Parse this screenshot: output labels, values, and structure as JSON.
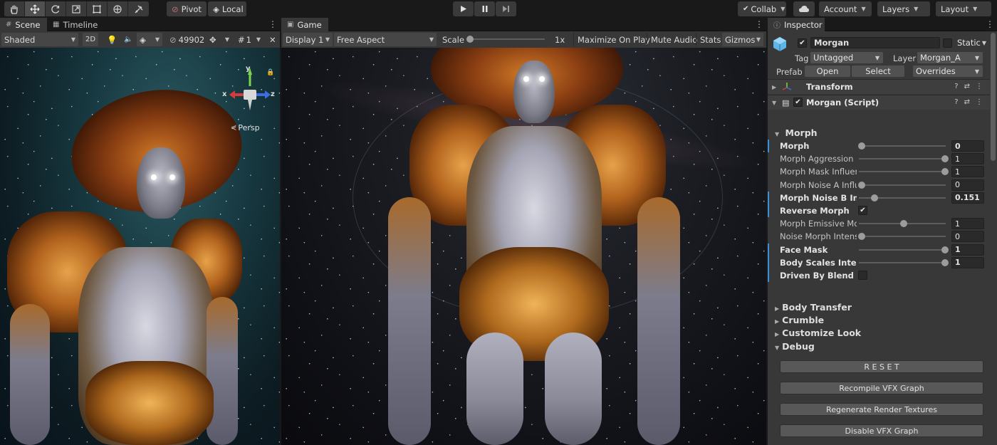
{
  "toolbar": {
    "tools": [
      "hand-tool",
      "move-tool",
      "rotate-tool",
      "scale-tool",
      "rect-tool",
      "transform-tool",
      "custom-tool"
    ],
    "pivot_label": "Pivot",
    "local_label": "Local",
    "collab_label": "Collab",
    "account_label": "Account",
    "layers_label": "Layers",
    "layout_label": "Layout"
  },
  "scene_panel": {
    "tabs": [
      {
        "label": "Scene"
      },
      {
        "label": "Timeline"
      }
    ],
    "shading_mode": "Shaded",
    "mode_2d": "2D",
    "vertex_count": "49902",
    "layer_count": "1",
    "gizmo": {
      "x": "x",
      "y": "y",
      "z": "z",
      "view_label": "Persp"
    }
  },
  "game_panel": {
    "tab_label": "Game",
    "display": "Display 1",
    "aspect": "Free Aspect",
    "scale_label": "Scale",
    "scale_value": 0,
    "scale_readout": "1x",
    "maximize_label": "Maximize On Play",
    "mute_label": "Mute Audio",
    "stats_label": "Stats",
    "gizmos_label": "Gizmos"
  },
  "inspector": {
    "tab_label": "Inspector",
    "object_name": "Morgan",
    "active": true,
    "static_label": "Static",
    "tag_label": "Tag",
    "tag_value": "Untagged",
    "layer_label": "Layer",
    "layer_value": "Morgan_A",
    "prefab_label": "Prefab",
    "open_label": "Open",
    "select_label": "Select",
    "overrides_label": "Overrides",
    "transform_title": "Transform",
    "script_title": "Morgan (Script)",
    "morph_section": "Morph",
    "properties": [
      {
        "label": "Morph",
        "value": "0",
        "slider": 0.0,
        "bold": true,
        "bar": true
      },
      {
        "label": "Morph Aggression",
        "value": "1",
        "slider": 1.0,
        "bold": false,
        "bar": false
      },
      {
        "label": "Morph Mask Influence",
        "value": "1",
        "slider": 1.0,
        "bold": false,
        "bar": false
      },
      {
        "label": "Morph Noise A Influence",
        "value": "0",
        "slider": 0.0,
        "bold": false,
        "bar": false
      },
      {
        "label": "Morph Noise B Influence",
        "value": "0.151",
        "slider": 0.151,
        "bold": true,
        "bar": true
      },
      {
        "label": "Reverse Morph",
        "checkbox": true,
        "bold": true,
        "bar": true
      },
      {
        "label": "Morph Emissive Mod",
        "value": "1",
        "slider": 0.5,
        "bold": false,
        "bar": false
      },
      {
        "label": "Noise Morph Intensity",
        "value": "0",
        "slider": 0.0,
        "bold": false,
        "bar": false
      },
      {
        "label": "Face Mask",
        "value": "1",
        "slider": 1.0,
        "bold": true,
        "bar": true
      },
      {
        "label": "Body Scales Intensity",
        "value": "1",
        "slider": 1.0,
        "bold": true,
        "bar": true
      },
      {
        "label": "Driven By Blend Shape",
        "checkbox": false,
        "bold": true,
        "bar": true
      }
    ],
    "foldouts": [
      "Body Transfer",
      "Crumble",
      "Customize Look",
      "Debug"
    ],
    "debug_buttons": [
      "R E S E T",
      "Recompile VFX Graph",
      "Regenerate Render Textures",
      "Disable VFX Graph"
    ]
  }
}
